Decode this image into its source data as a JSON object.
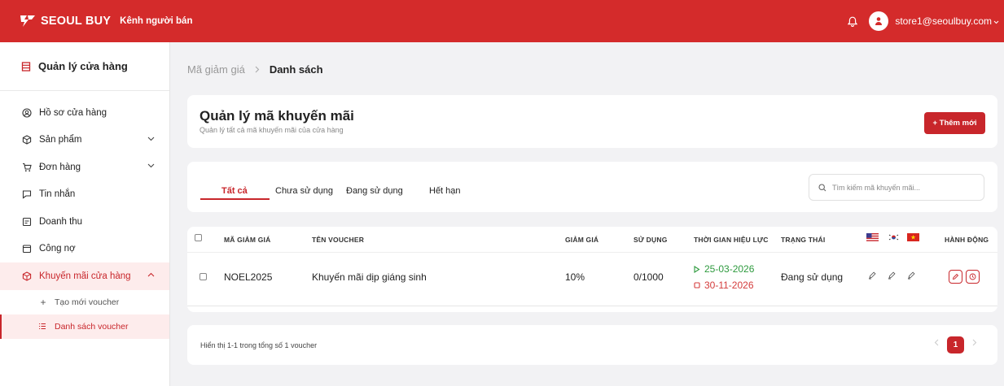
{
  "header": {
    "brand": "SEOUL BUY",
    "subtitle": "Kênh người bán",
    "user_email": "store1@seoulbuy.com"
  },
  "sidebar": {
    "title": "Quản lý cửa hàng",
    "items": [
      {
        "label": "Hồ sơ cửa hàng",
        "icon": "user-circle-icon"
      },
      {
        "label": "Sản phẩm",
        "icon": "box-icon",
        "expandable": true
      },
      {
        "label": "Đơn hàng",
        "icon": "cart-icon",
        "expandable": true
      },
      {
        "label": "Tin nhắn",
        "icon": "chat-icon"
      },
      {
        "label": "Doanh thu",
        "icon": "revenue-icon"
      },
      {
        "label": "Công nợ",
        "icon": "wallet-icon"
      },
      {
        "label": "Khuyến mãi cửa hàng",
        "icon": "promotion-icon",
        "expanded": true
      }
    ],
    "subitems": [
      {
        "label": "Tạo mới voucher",
        "icon": "plus-icon"
      },
      {
        "label": "Danh sách voucher",
        "icon": "list-icon",
        "active": true
      }
    ]
  },
  "breadcrumb": {
    "parent": "Mã giảm giá",
    "current": "Danh sách"
  },
  "page": {
    "title": "Quản lý mã khuyến mãi",
    "subtitle": "Quản lý tất cả mã khuyến mãi của cửa hàng",
    "add_button": "+ Thêm mới"
  },
  "tabs": [
    "Tất cả",
    "Chưa sử dụng",
    "Đang sử dụng",
    "Hết hạn"
  ],
  "active_tab": 0,
  "search": {
    "placeholder": "Tìm kiếm mã khuyến mãi..."
  },
  "table": {
    "headers": {
      "code": "MÃ GIẢM GIÁ",
      "name": "TÊN VOUCHER",
      "discount": "GIẢM GIÁ",
      "usage": "SỬ DỤNG",
      "validity": "THỜI GIAN HIỆU LỰC",
      "status": "TRẠNG THÁI",
      "actions": "HÀNH ĐỘNG"
    },
    "language_flags": [
      "us-flag-icon",
      "kr-flag-icon",
      "vn-flag-icon"
    ],
    "rows": [
      {
        "code": "NOEL2025",
        "name": "Khuyến mãi dịp giáng sinh",
        "discount": "10%",
        "usage": "0/1000",
        "start_date": "25-03-2026",
        "end_date": "30-11-2026",
        "status": "Đang sử dụng"
      }
    ]
  },
  "footer": {
    "summary": "Hiển thị 1-1 trong tổng số 1 voucher",
    "current_page": "1"
  },
  "colors": {
    "primary": "#c8262b",
    "topbar": "#d42b2b",
    "start_date": "#2e9a3e",
    "end_date": "#d43b3b"
  }
}
